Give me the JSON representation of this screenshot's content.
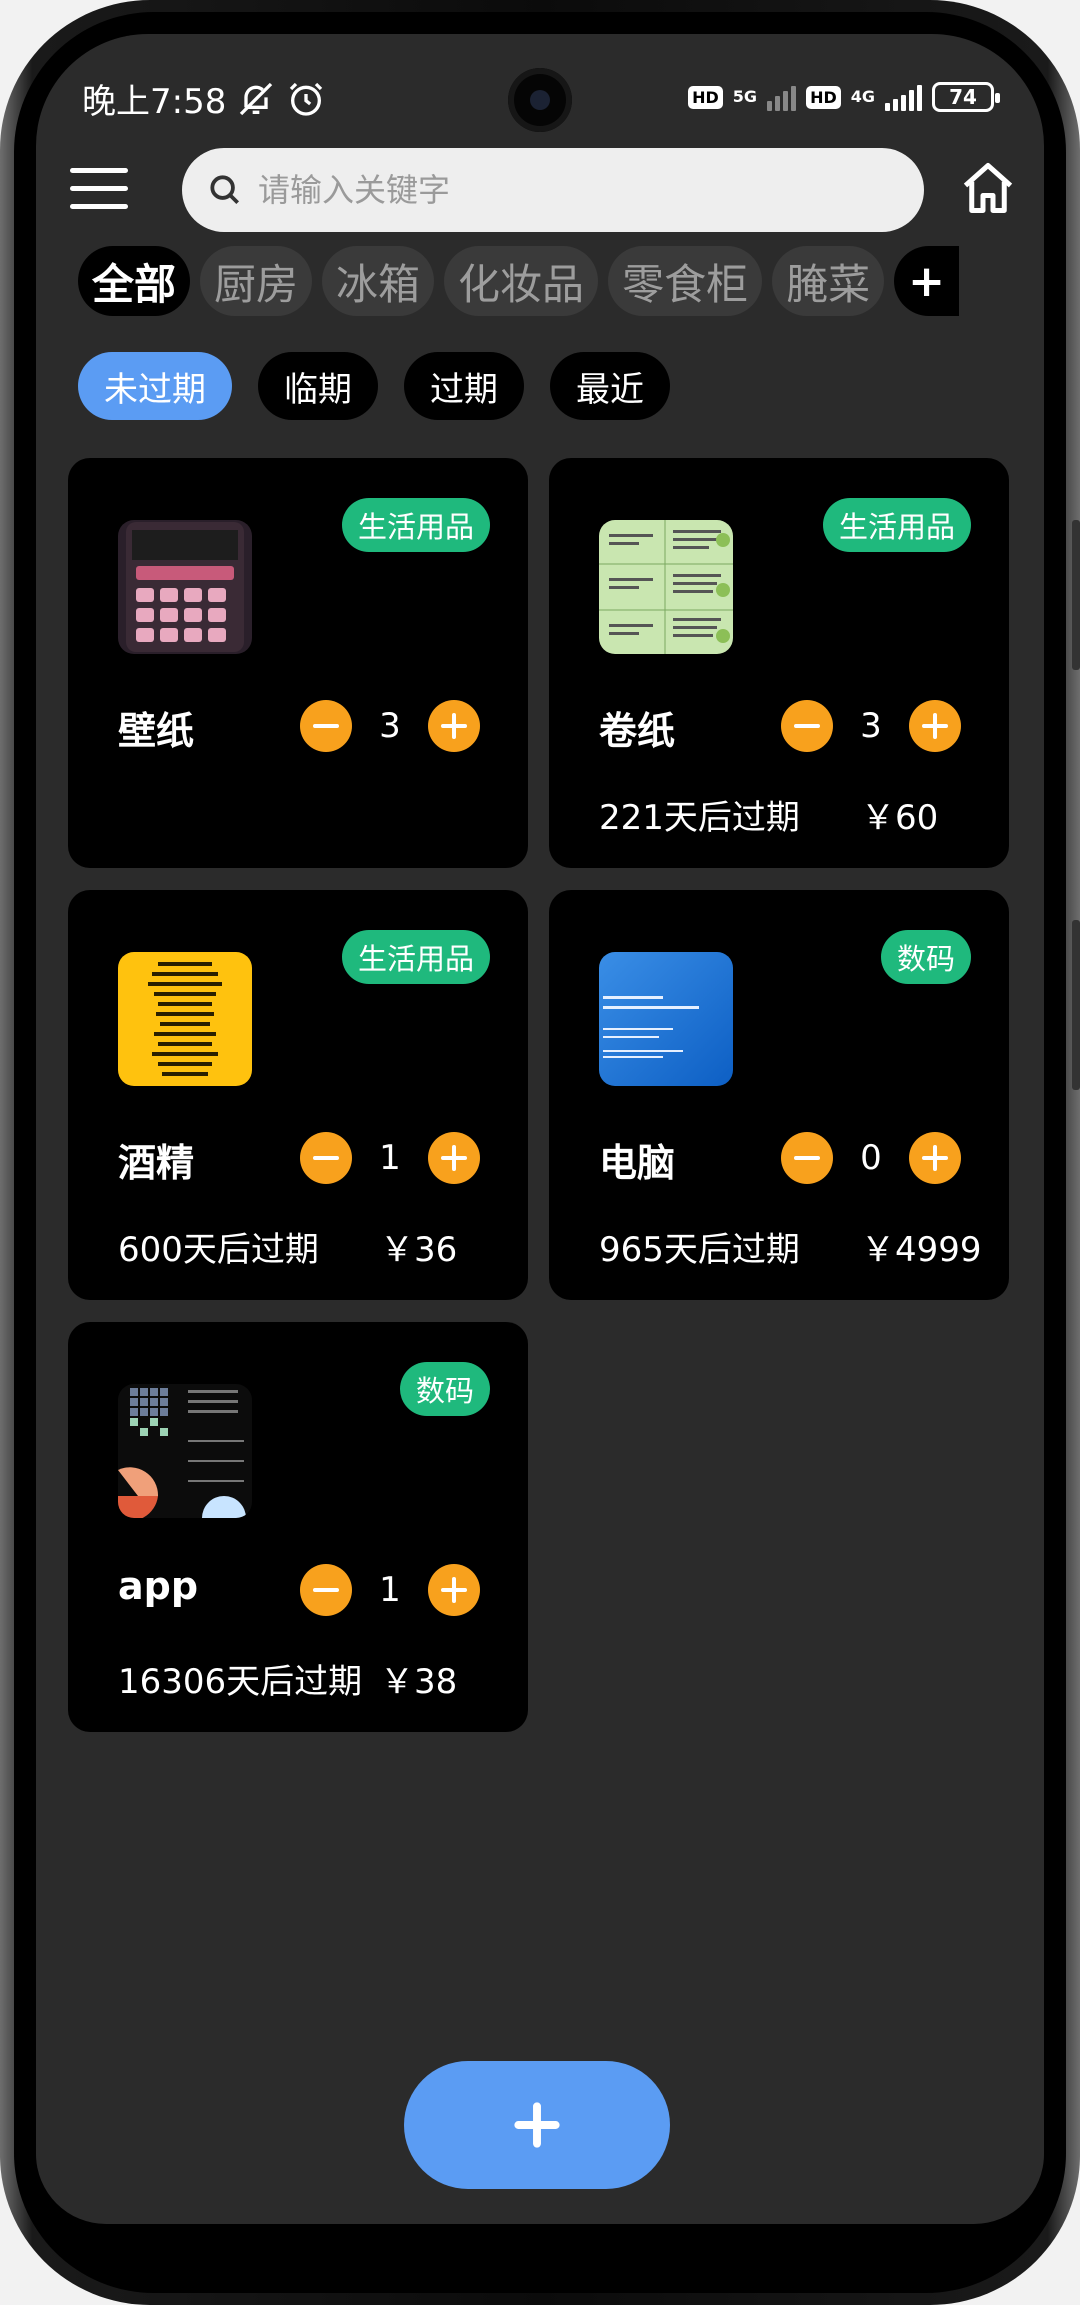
{
  "status_bar": {
    "time": "晚上7:58",
    "sim1_label": "HD",
    "sim1_network": "5G",
    "sim2_label": "HD",
    "sim2_network": "4G",
    "battery": "74"
  },
  "search": {
    "placeholder": "请输入关键字"
  },
  "categories": [
    {
      "label": "全部",
      "active": true
    },
    {
      "label": "厨房"
    },
    {
      "label": "冰箱"
    },
    {
      "label": "化妆品"
    },
    {
      "label": "零食柜"
    },
    {
      "label": "腌菜"
    }
  ],
  "category_add_label": "+",
  "filters": [
    {
      "label": "未过期",
      "active": true
    },
    {
      "label": "临期"
    },
    {
      "label": "过期"
    },
    {
      "label": "最近"
    }
  ],
  "items": [
    {
      "name": "壁纸",
      "tag": "生活用品",
      "quantity": "3",
      "expiry": "",
      "price": ""
    },
    {
      "name": "卷纸",
      "tag": "生活用品",
      "quantity": "3",
      "expiry": "221天后过期",
      "price": "￥60"
    },
    {
      "name": "酒精",
      "tag": "生活用品",
      "quantity": "1",
      "expiry": "600天后过期",
      "price": "￥36"
    },
    {
      "name": "电脑",
      "tag": "数码",
      "quantity": "0",
      "expiry": "965天后过期",
      "price": "￥4999"
    },
    {
      "name": "app",
      "tag": "数码",
      "quantity": "1",
      "expiry": "16306天后过期",
      "price": "￥38"
    }
  ],
  "colors": {
    "background": "#2b2b2b",
    "card": "#000000",
    "accent_blue": "#5b9cf3",
    "tag_green": "#1fb97d",
    "stepper_orange": "#f8a11d"
  },
  "icons": {
    "menu": "menu-icon",
    "search": "search-icon",
    "home": "home-icon",
    "add": "plus-icon",
    "mute": "bell-off-icon",
    "alarm": "alarm-icon"
  }
}
